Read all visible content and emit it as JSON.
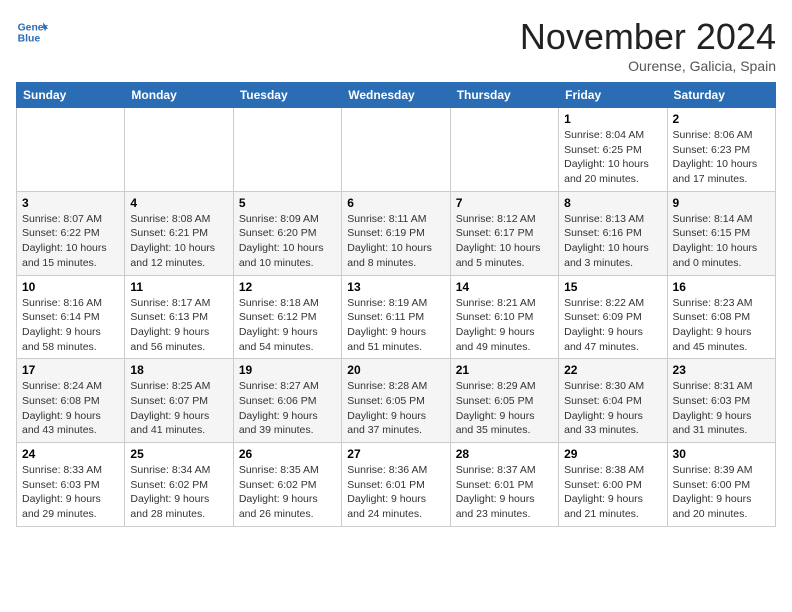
{
  "header": {
    "logo_line1": "General",
    "logo_line2": "Blue",
    "month": "November 2024",
    "location": "Ourense, Galicia, Spain"
  },
  "weekdays": [
    "Sunday",
    "Monday",
    "Tuesday",
    "Wednesday",
    "Thursday",
    "Friday",
    "Saturday"
  ],
  "weeks": [
    [
      {
        "day": "",
        "info": ""
      },
      {
        "day": "",
        "info": ""
      },
      {
        "day": "",
        "info": ""
      },
      {
        "day": "",
        "info": ""
      },
      {
        "day": "",
        "info": ""
      },
      {
        "day": "1",
        "info": "Sunrise: 8:04 AM\nSunset: 6:25 PM\nDaylight: 10 hours\nand 20 minutes."
      },
      {
        "day": "2",
        "info": "Sunrise: 8:06 AM\nSunset: 6:23 PM\nDaylight: 10 hours\nand 17 minutes."
      }
    ],
    [
      {
        "day": "3",
        "info": "Sunrise: 8:07 AM\nSunset: 6:22 PM\nDaylight: 10 hours\nand 15 minutes."
      },
      {
        "day": "4",
        "info": "Sunrise: 8:08 AM\nSunset: 6:21 PM\nDaylight: 10 hours\nand 12 minutes."
      },
      {
        "day": "5",
        "info": "Sunrise: 8:09 AM\nSunset: 6:20 PM\nDaylight: 10 hours\nand 10 minutes."
      },
      {
        "day": "6",
        "info": "Sunrise: 8:11 AM\nSunset: 6:19 PM\nDaylight: 10 hours\nand 8 minutes."
      },
      {
        "day": "7",
        "info": "Sunrise: 8:12 AM\nSunset: 6:17 PM\nDaylight: 10 hours\nand 5 minutes."
      },
      {
        "day": "8",
        "info": "Sunrise: 8:13 AM\nSunset: 6:16 PM\nDaylight: 10 hours\nand 3 minutes."
      },
      {
        "day": "9",
        "info": "Sunrise: 8:14 AM\nSunset: 6:15 PM\nDaylight: 10 hours\nand 0 minutes."
      }
    ],
    [
      {
        "day": "10",
        "info": "Sunrise: 8:16 AM\nSunset: 6:14 PM\nDaylight: 9 hours\nand 58 minutes."
      },
      {
        "day": "11",
        "info": "Sunrise: 8:17 AM\nSunset: 6:13 PM\nDaylight: 9 hours\nand 56 minutes."
      },
      {
        "day": "12",
        "info": "Sunrise: 8:18 AM\nSunset: 6:12 PM\nDaylight: 9 hours\nand 54 minutes."
      },
      {
        "day": "13",
        "info": "Sunrise: 8:19 AM\nSunset: 6:11 PM\nDaylight: 9 hours\nand 51 minutes."
      },
      {
        "day": "14",
        "info": "Sunrise: 8:21 AM\nSunset: 6:10 PM\nDaylight: 9 hours\nand 49 minutes."
      },
      {
        "day": "15",
        "info": "Sunrise: 8:22 AM\nSunset: 6:09 PM\nDaylight: 9 hours\nand 47 minutes."
      },
      {
        "day": "16",
        "info": "Sunrise: 8:23 AM\nSunset: 6:08 PM\nDaylight: 9 hours\nand 45 minutes."
      }
    ],
    [
      {
        "day": "17",
        "info": "Sunrise: 8:24 AM\nSunset: 6:08 PM\nDaylight: 9 hours\nand 43 minutes."
      },
      {
        "day": "18",
        "info": "Sunrise: 8:25 AM\nSunset: 6:07 PM\nDaylight: 9 hours\nand 41 minutes."
      },
      {
        "day": "19",
        "info": "Sunrise: 8:27 AM\nSunset: 6:06 PM\nDaylight: 9 hours\nand 39 minutes."
      },
      {
        "day": "20",
        "info": "Sunrise: 8:28 AM\nSunset: 6:05 PM\nDaylight: 9 hours\nand 37 minutes."
      },
      {
        "day": "21",
        "info": "Sunrise: 8:29 AM\nSunset: 6:05 PM\nDaylight: 9 hours\nand 35 minutes."
      },
      {
        "day": "22",
        "info": "Sunrise: 8:30 AM\nSunset: 6:04 PM\nDaylight: 9 hours\nand 33 minutes."
      },
      {
        "day": "23",
        "info": "Sunrise: 8:31 AM\nSunset: 6:03 PM\nDaylight: 9 hours\nand 31 minutes."
      }
    ],
    [
      {
        "day": "24",
        "info": "Sunrise: 8:33 AM\nSunset: 6:03 PM\nDaylight: 9 hours\nand 29 minutes."
      },
      {
        "day": "25",
        "info": "Sunrise: 8:34 AM\nSunset: 6:02 PM\nDaylight: 9 hours\nand 28 minutes."
      },
      {
        "day": "26",
        "info": "Sunrise: 8:35 AM\nSunset: 6:02 PM\nDaylight: 9 hours\nand 26 minutes."
      },
      {
        "day": "27",
        "info": "Sunrise: 8:36 AM\nSunset: 6:01 PM\nDaylight: 9 hours\nand 24 minutes."
      },
      {
        "day": "28",
        "info": "Sunrise: 8:37 AM\nSunset: 6:01 PM\nDaylight: 9 hours\nand 23 minutes."
      },
      {
        "day": "29",
        "info": "Sunrise: 8:38 AM\nSunset: 6:00 PM\nDaylight: 9 hours\nand 21 minutes."
      },
      {
        "day": "30",
        "info": "Sunrise: 8:39 AM\nSunset: 6:00 PM\nDaylight: 9 hours\nand 20 minutes."
      }
    ]
  ]
}
